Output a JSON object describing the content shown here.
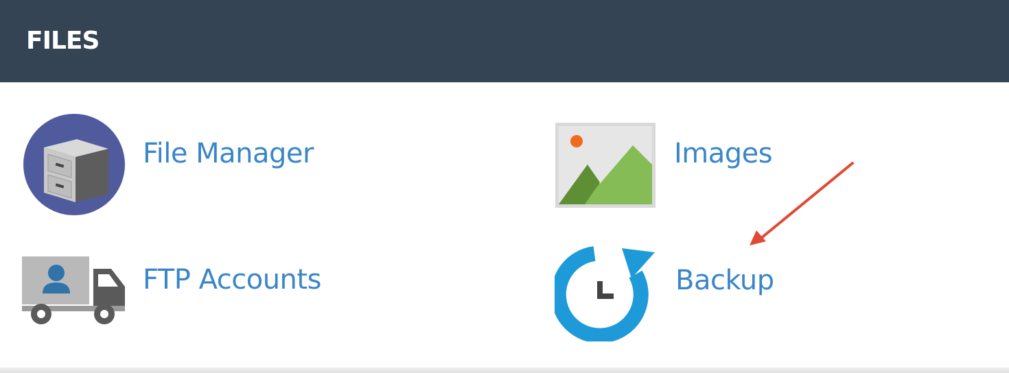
{
  "section": {
    "title": "FILES"
  },
  "items": [
    {
      "label": "File Manager",
      "icon": "file-cabinet-icon"
    },
    {
      "label": "Images",
      "icon": "image-icon"
    },
    {
      "label": "FTP Accounts",
      "icon": "ftp-truck-icon"
    },
    {
      "label": "Backup",
      "icon": "backup-clock-icon"
    }
  ],
  "colors": {
    "header_bg": "#344454",
    "link": "#3a86c8",
    "annotation_arrow": "#e04a35"
  }
}
